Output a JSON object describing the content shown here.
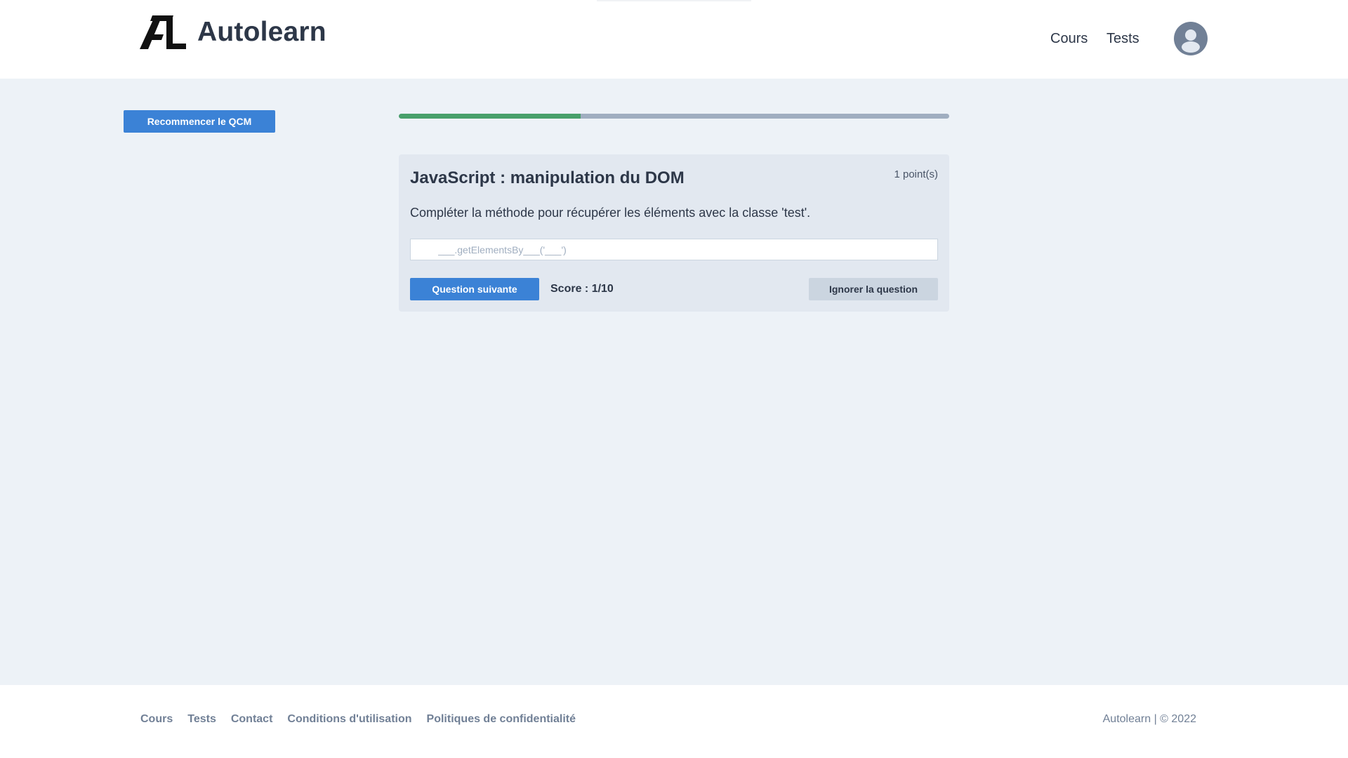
{
  "header": {
    "logo_text": "Autolearn",
    "nav": [
      {
        "label": "Cours"
      },
      {
        "label": "Tests"
      }
    ]
  },
  "main": {
    "restart_button": "Recommencer le QCM",
    "progress_fraction": 0.33,
    "colors": {
      "progress_fill": "#48a06a",
      "progress_track": "#a0aec0",
      "primary_button": "#3b82d6"
    },
    "question": {
      "title": "JavaScript : manipulation du DOM",
      "points": "1 point(s)",
      "text": "Compléter la méthode pour récupérer les éléments avec la classe 'test'.",
      "input_placeholder": "___.getElementsBy___('___')",
      "input_value": "",
      "next_button": "Question suivante",
      "score": "Score : 1/10",
      "skip_button": "Ignorer la question"
    }
  },
  "footer": {
    "links": [
      {
        "label": "Cours"
      },
      {
        "label": "Tests"
      },
      {
        "label": "Contact"
      },
      {
        "label": "Conditions d'utilisation"
      },
      {
        "label": "Politiques de confidentialité"
      }
    ],
    "copyright": "Autolearn | © 2022"
  }
}
